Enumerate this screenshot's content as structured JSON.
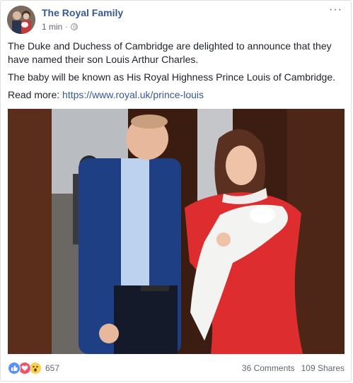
{
  "post": {
    "page_name": "The Royal Family",
    "time": "1 min",
    "separator": "·",
    "more": "···",
    "paragraphs": [
      "The Duke and Duchess of Cambridge are delighted to announce that they have named their son Louis Arthur Charles.",
      "The baby will be known as His Royal Highness Prince Louis of Cambridge."
    ],
    "read_more_label": "Read more: ",
    "link": "https://www.royal.uk/prince-louis"
  },
  "footer": {
    "reactions": [
      "like-icon",
      "love-icon",
      "wow-icon"
    ],
    "reaction_count": "657",
    "comments": "36 Comments",
    "shares": "109 Shares"
  },
  "colors": {
    "link": "#365899",
    "like": "#5890ff",
    "love": "#f25268",
    "wow": "#fcd050"
  }
}
